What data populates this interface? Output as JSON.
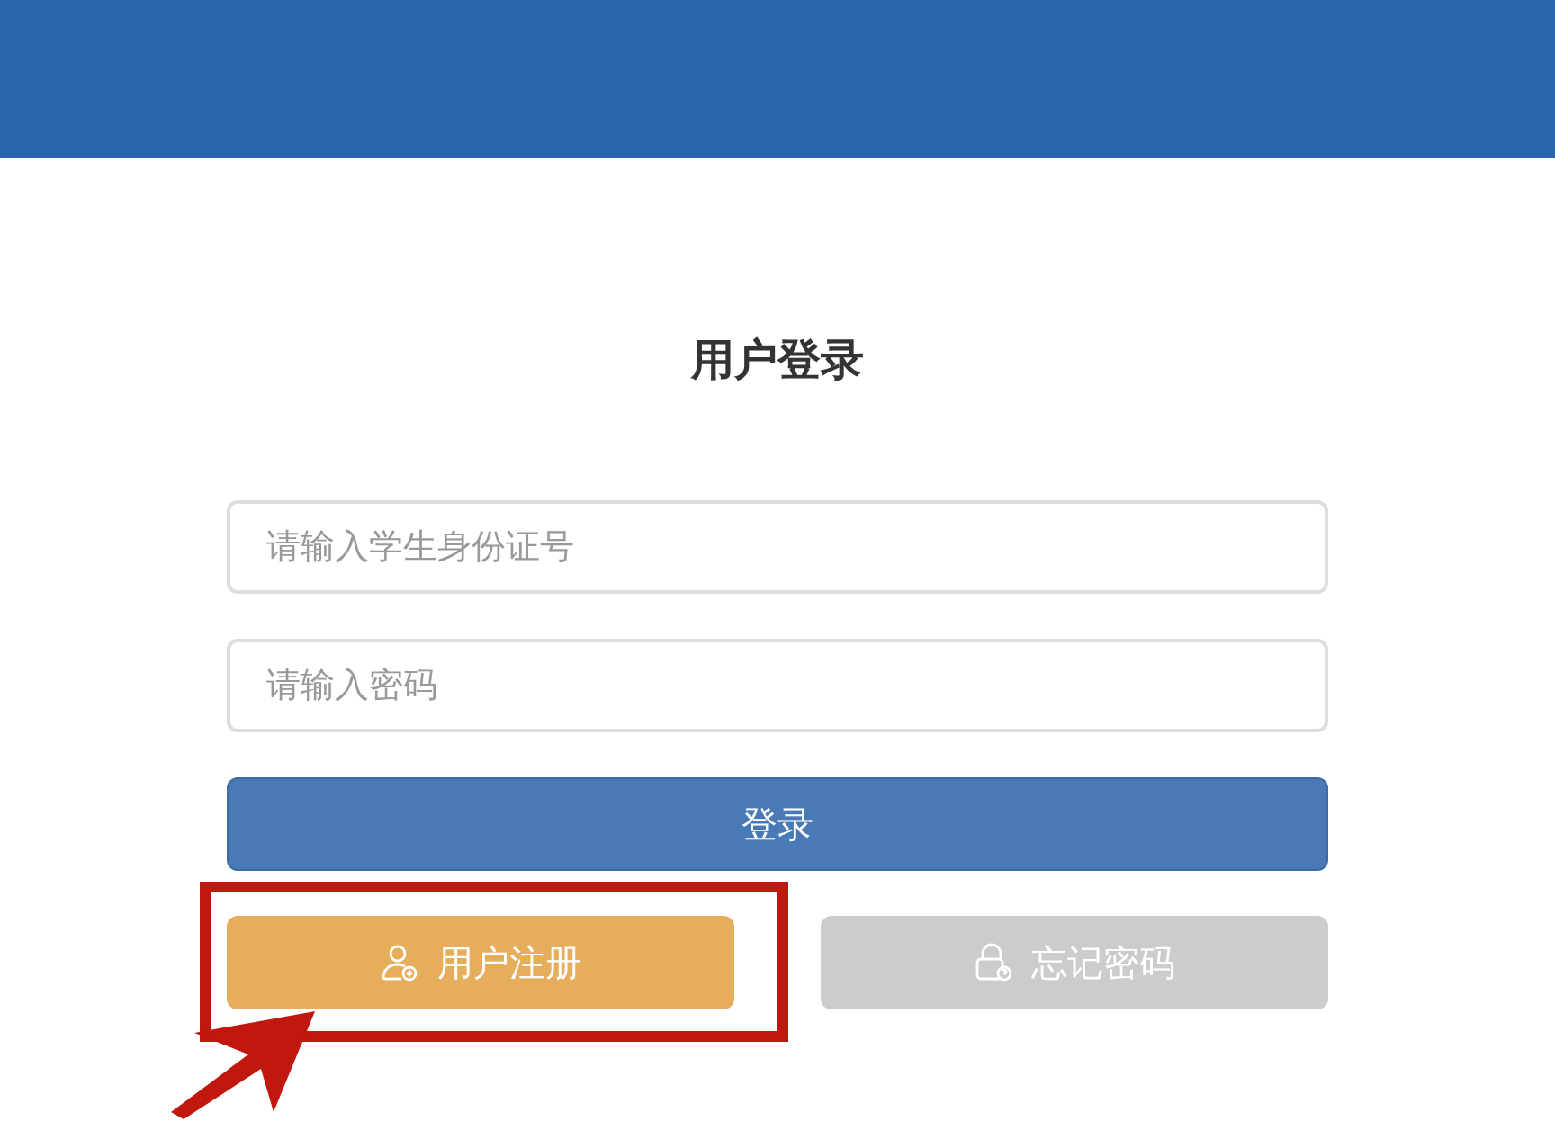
{
  "title": "用户登录",
  "fields": [
    {
      "placeholder": "请输入学生身份证号"
    },
    {
      "placeholder": "请输入密码"
    }
  ],
  "login_button": "登录",
  "secondary_buttons": [
    {
      "kind": "register",
      "label": "用户注册"
    },
    {
      "kind": "forgot",
      "label": "忘记密码"
    }
  ]
}
